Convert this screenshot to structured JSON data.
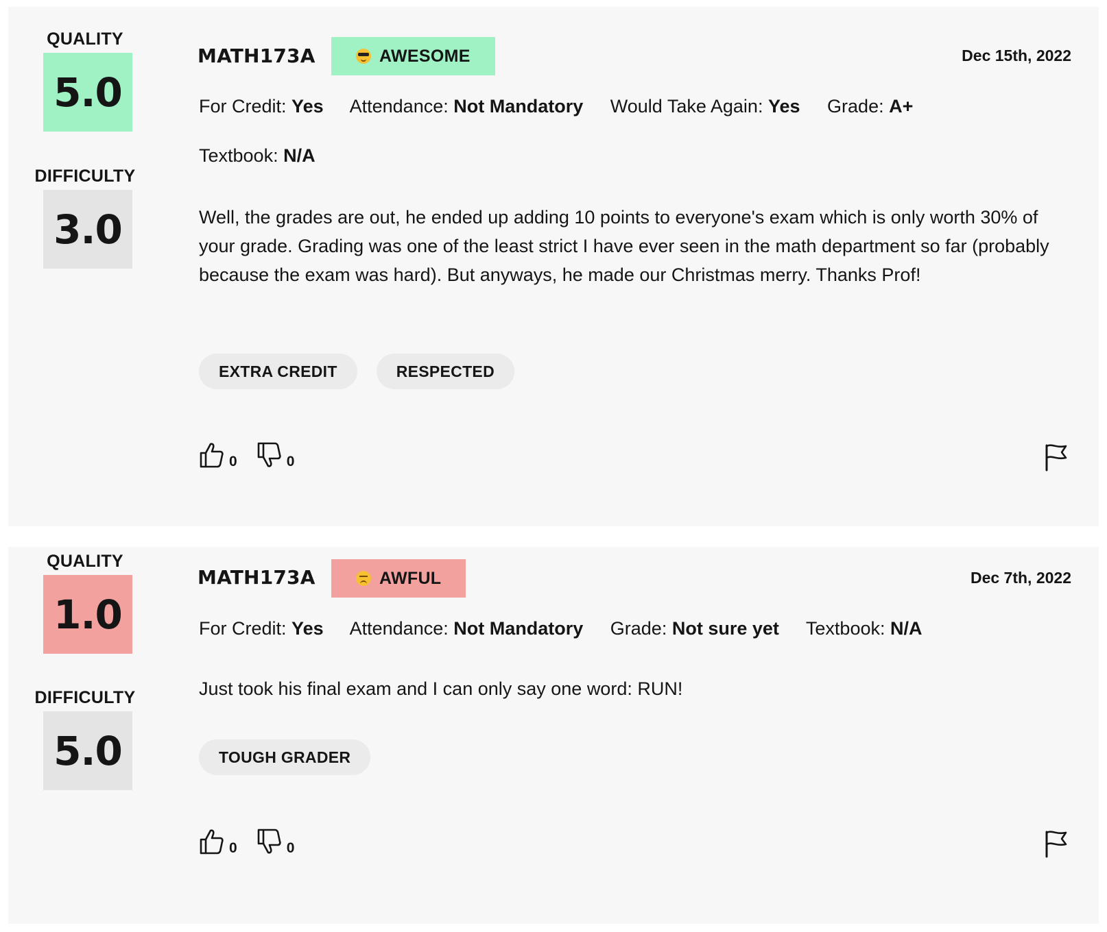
{
  "colors": {
    "card_background": "#f7f7f7",
    "quality_awesome": "#a0f2c5",
    "quality_awful": "#f2a19e",
    "difficulty_box": "#e4e4e4",
    "tag_background": "#ebebeb",
    "text": "#151515"
  },
  "reviews": [
    {
      "quality_label": "QUALITY",
      "quality_score": "5.0",
      "difficulty_label": "DIFFICULTY",
      "difficulty_score": "3.0",
      "course": "MATH173A",
      "rating_text": "AWESOME",
      "rating_emoji_icon": "cool-face-emoji-icon",
      "date": "Dec 15th, 2022",
      "meta": [
        {
          "label": "For Credit:",
          "value": "Yes"
        },
        {
          "label": "Attendance:",
          "value": "Not Mandatory"
        },
        {
          "label": "Would Take Again:",
          "value": "Yes"
        },
        {
          "label": "Grade:",
          "value": "A+"
        },
        {
          "label": "Textbook:",
          "value": "N/A"
        }
      ],
      "comment": "Well, the grades are out, he ended up adding 10 points to everyone's exam which is only worth 30% of your grade. Grading was one of the least strict I have ever seen in the math department so far (probably because the exam was hard). But anyways, he made our Christmas merry. Thanks Prof!",
      "tags": [
        "EXTRA CREDIT",
        "RESPECTED"
      ],
      "thumbs_up_count": "0",
      "thumbs_down_count": "0"
    },
    {
      "quality_label": "QUALITY",
      "quality_score": "1.0",
      "difficulty_label": "DIFFICULTY",
      "difficulty_score": "5.0",
      "course": "MATH173A",
      "rating_text": "AWFUL",
      "rating_emoji_icon": "angry-face-emoji-icon",
      "date": "Dec 7th, 2022",
      "meta": [
        {
          "label": "For Credit:",
          "value": "Yes"
        },
        {
          "label": "Attendance:",
          "value": "Not Mandatory"
        },
        {
          "label": "Grade:",
          "value": "Not sure yet"
        },
        {
          "label": "Textbook:",
          "value": "N/A"
        }
      ],
      "comment": "Just took his final exam and I can only say one word: RUN!",
      "tags": [
        "TOUGH GRADER"
      ],
      "thumbs_up_count": "0",
      "thumbs_down_count": "0"
    }
  ]
}
